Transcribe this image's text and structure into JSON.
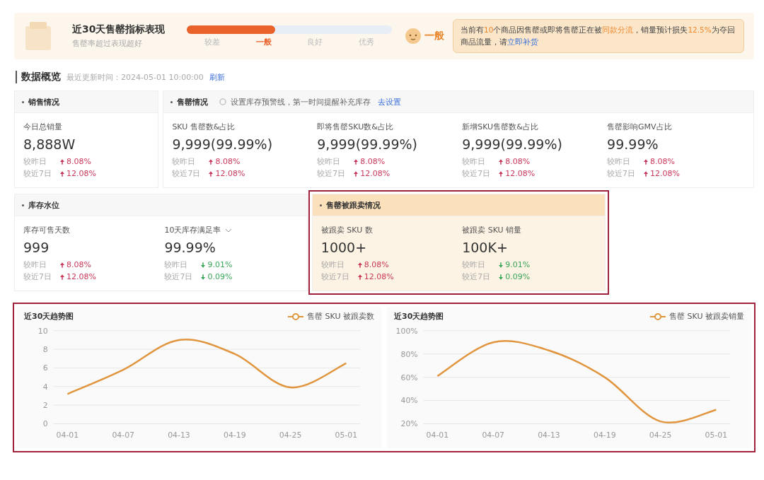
{
  "banner": {
    "title": "近30天售罄指标表现",
    "subtitle": "售罄率超过表现超好",
    "scale": {
      "level": 0.43,
      "labels": [
        {
          "label": "较差",
          "selected": false
        },
        {
          "label": "一般",
          "selected": true
        },
        {
          "label": "良好",
          "selected": false
        },
        {
          "label": "优秀",
          "selected": false
        }
      ]
    },
    "rating": "一般",
    "alert": [
      {
        "text": "当前有",
        "kind": "plain"
      },
      {
        "text": "10",
        "kind": "highlight"
      },
      {
        "text": "个商品因售罄或即将售罄正在被",
        "kind": "plain"
      },
      {
        "text": "同款分流",
        "kind": "highlight"
      },
      {
        "text": "，销量预计损失",
        "kind": "plain"
      },
      {
        "text": "12.5%",
        "kind": "highlight"
      },
      {
        "text": "为夺回商品流量，请",
        "kind": "plain"
      },
      {
        "text": "立即补货",
        "kind": "link"
      }
    ]
  },
  "overview": {
    "title": "数据概览",
    "updated": "最近更新时间：2024-05-01 10:00:00",
    "refresh": "刷新"
  },
  "cards": [
    {
      "title": "销售情况",
      "highlighted": false,
      "metrics": [
        {
          "label": "今日总销量",
          "value": "8,888W",
          "compare": [
            {
              "label": "较昨日",
              "up": true,
              "value": "8.08%"
            },
            {
              "label": "较近7日",
              "up": true,
              "value": "12.08%"
            }
          ]
        }
      ]
    },
    {
      "title": "售罄情况",
      "highlighted": false,
      "hint": "设置库存预警线，第一时间提醒补充库存",
      "hint_link": "去设置",
      "metrics": [
        {
          "label": "SKU 售罄数&占比",
          "value": "9,999(99.99%)",
          "compare": [
            {
              "label": "较昨日",
              "up": true,
              "value": "8.08%"
            },
            {
              "label": "较近7日",
              "up": true,
              "value": "12.08%"
            }
          ]
        },
        {
          "label": "即将售罄SKU数&占比",
          "value": "9,999(99.99%)",
          "compare": [
            {
              "label": "较昨日",
              "up": true,
              "value": "8.08%"
            },
            {
              "label": "较近7日",
              "up": true,
              "value": "12.08%"
            }
          ]
        },
        {
          "label": "新增SKU售罄数&占比",
          "value": "9,999(99.99%)",
          "compare": [
            {
              "label": "较昨日",
              "up": true,
              "value": "8.08%"
            },
            {
              "label": "较近7日",
              "up": true,
              "value": "12.08%"
            }
          ]
        },
        {
          "label": "售罄影响GMV占比",
          "value": "99.99%",
          "compare": [
            {
              "label": "较昨日",
              "up": true,
              "value": "8.08%"
            },
            {
              "label": "较近7日",
              "up": true,
              "value": "12.08%"
            }
          ]
        }
      ]
    },
    {
      "title": "库存水位",
      "highlighted": false,
      "metrics": [
        {
          "label": "库存可售天数",
          "value": "999",
          "compare": [
            {
              "label": "较昨日",
              "up": true,
              "value": "8.08%"
            },
            {
              "label": "较近7日",
              "up": true,
              "value": "12.08%"
            }
          ]
        },
        {
          "label": "10天库存满足率",
          "dropdown": true,
          "value": "99.99%",
          "compare": [
            {
              "label": "较昨日",
              "up": false,
              "value": "9.01%"
            },
            {
              "label": "较近7日",
              "up": false,
              "value": "0.09%"
            }
          ]
        }
      ]
    },
    {
      "title": "售罄被跟卖情况",
      "highlighted": true,
      "metrics": [
        {
          "label": "被跟卖 SKU 数",
          "value": "1000+",
          "compare": [
            {
              "label": "较昨日",
              "up": true,
              "value": "8.08%"
            },
            {
              "label": "较近7日",
              "up": true,
              "value": "12.08%"
            }
          ]
        },
        {
          "label": "被跟卖 SKU 销量",
          "value": "100K+",
          "compare": [
            {
              "label": "较昨日",
              "up": false,
              "value": "9.01%"
            },
            {
              "label": "较近7日",
              "up": false,
              "value": "0.09%"
            }
          ]
        }
      ]
    }
  ],
  "charts": {
    "highlighted": true,
    "items": [
      {
        "chart_data": {
          "type": "line",
          "title": "近30天趋势图",
          "categories": [
            "04-01",
            "04-07",
            "04-13",
            "04-19",
            "04-25",
            "05-01"
          ],
          "series": [
            {
              "name": "售罄 SKU 被跟卖数",
              "color": "#e0953e",
              "values": [
                3.2,
                5.8,
                9.0,
                7.5,
                3.9,
                6.5
              ]
            }
          ],
          "ylim": [
            0,
            10
          ],
          "grid": true,
          "yticks": [
            0,
            2,
            4,
            6,
            8,
            10
          ]
        }
      },
      {
        "chart_data": {
          "type": "line",
          "title": "近30天趋势图",
          "categories": [
            "04-01",
            "04-07",
            "04-13",
            "04-19",
            "04-25",
            "05-01"
          ],
          "series": [
            {
              "name": "售罄 SKU 被跟卖销量",
              "color": "#e0953e",
              "values": [
                61,
                90,
                83,
                60,
                22,
                32
              ]
            }
          ],
          "ylim": [
            20,
            100
          ],
          "grid": true,
          "yticks": [
            {
              "value": 20,
              "label": "20%"
            },
            {
              "value": 40,
              "label": "40%"
            },
            {
              "value": 60,
              "label": "60%"
            },
            {
              "value": 80,
              "label": "80%"
            },
            {
              "value": 100,
              "label": "100%"
            }
          ]
        }
      }
    ]
  }
}
